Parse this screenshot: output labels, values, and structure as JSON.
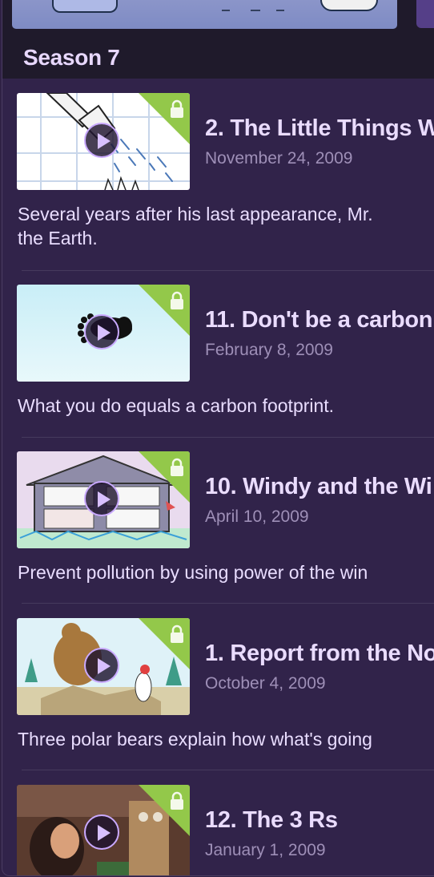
{
  "season": {
    "title": "Season 7"
  },
  "episodes": [
    {
      "title": "2. The Little Things W",
      "date": "November 24, 2009",
      "description_lines": [
        "Several years after his last appearance, Mr.",
        "the Earth."
      ],
      "thumbnail": "shower-head-cartoon",
      "locked": true
    },
    {
      "title": "11. Don't be a carbon",
      "date": "February 8, 2009",
      "description_lines": [
        "What you do equals a carbon footprint."
      ],
      "thumbnail": "footprint-cartoon",
      "locked": true
    },
    {
      "title": "10. Windy and the Wi",
      "date": "April 10, 2009",
      "description_lines": [
        "Prevent pollution by using power of the win"
      ],
      "thumbnail": "house-cross-section-cartoon",
      "locked": true
    },
    {
      "title": "1. Report from the No",
      "date": "October 4, 2009",
      "description_lines": [
        "Three polar bears explain how what's going"
      ],
      "thumbnail": "bears-on-landfill-cartoon",
      "locked": true
    },
    {
      "title": "12. The 3 Rs",
      "date": "January 1, 2009",
      "description_lines": [],
      "thumbnail": "kids-with-robot-photo",
      "locked": true
    }
  ],
  "icons": {
    "play": "play-icon",
    "lock": "lock-icon"
  },
  "colors": {
    "background": "#31234a",
    "header_band": "#1f1a2b",
    "title_text": "#eadcff",
    "date_text": "#9e8fb7",
    "play_ring": "#c9a9ff",
    "lock_corner": "#93c84a"
  }
}
